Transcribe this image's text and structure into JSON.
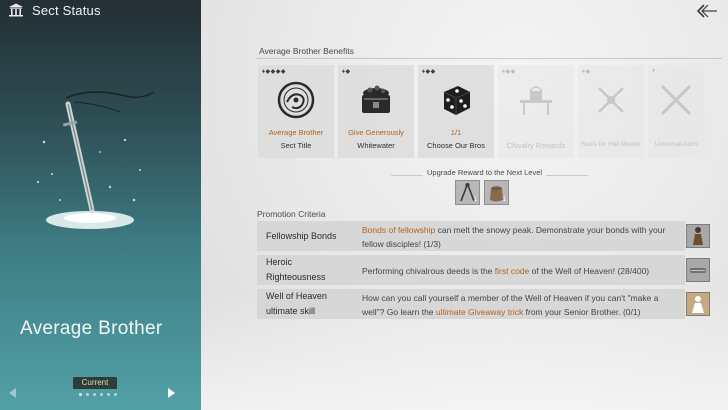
{
  "header": {
    "title": "Sect Status"
  },
  "left": {
    "rank_name": "Average Brother",
    "current_label": "Current",
    "page_count": 6,
    "page_index": 1
  },
  "benefits": {
    "section_title": "Average Brother Benefits",
    "cards": [
      {
        "pips": "♦◆◆◆◆",
        "line1": "Average Brother",
        "line2": "Sect Title",
        "icon": "round-sect-emblem-icon",
        "dim": false
      },
      {
        "pips": "♦◆",
        "line1": "Give Generously",
        "line2": "Whitewater",
        "icon": "treasure-chest-icon",
        "dim": false
      },
      {
        "pips": "♦◆◆",
        "line1": "1/1",
        "line2": "Choose Our Bros",
        "icon": "dice-icon",
        "dim": false
      },
      {
        "pips": "♦◆◆",
        "line1": "",
        "line2": "Chivalry Rewards",
        "icon": "gift-table-icon",
        "dim": true
      },
      {
        "pips": "♦◆",
        "line1": "",
        "line2": "Stalls for Hall Master",
        "icon": "crossed-daggers-icon",
        "dim": true
      },
      {
        "pips": "♦",
        "line1": "",
        "line2": "Universal Admi",
        "icon": "crossed-blades-icon",
        "dim": true
      }
    ]
  },
  "upgrade": {
    "label": "Upgrade Reward to the Next Level",
    "items": [
      {
        "icon": "compass-tool-icon",
        "count": "1"
      },
      {
        "icon": "leather-pouch-icon",
        "count": "1"
      }
    ]
  },
  "criteria": {
    "section_title": "Promotion Criteria",
    "rows": [
      {
        "name": "Fellowship Bonds",
        "hl1": "Bonds of fellowship",
        "text1": " can melt the snowy peak. Demonstrate your bonds with your fellow disciples! (1/3)",
        "pre": "",
        "icon": "warrior-figure-icon"
      },
      {
        "name": "Heroic Righteousness",
        "pre": "Performing chivalrous deeds is the ",
        "hl1": "first code",
        "text1": " of the Well of Heaven! (28/400)",
        "icon": "scroll-item-icon"
      },
      {
        "name": "Well of Heaven ultimate skill",
        "pre": "How can you call yourself a member of the Well of Heaven if you can't \"make a well\"? Go learn the ",
        "hl1": "ultimate Giveaway trick",
        "text1": " from your Senior Brother. (0/1)",
        "icon": "monk-figure-icon"
      }
    ]
  },
  "colors": {
    "accent": "#b3631f",
    "panel_teal": "#52a1a6"
  }
}
